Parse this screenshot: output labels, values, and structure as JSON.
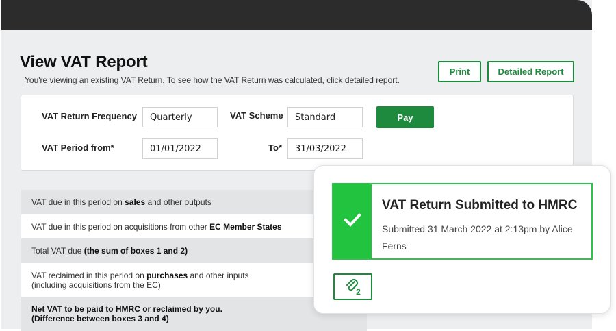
{
  "header": {
    "title": "View VAT Report",
    "subtitle": "You're viewing an existing VAT Return. To see how the VAT Return was calculated, click detailed report."
  },
  "actions": {
    "print_label": "Print",
    "detailed_label": "Detailed Report",
    "pay_label": "Pay"
  },
  "form": {
    "frequency_label": "VAT Return Frequency",
    "frequency_value": "Quarterly",
    "scheme_label": "VAT Scheme",
    "scheme_value": "Standard",
    "period_from_label": "VAT Period from*",
    "period_from_value": "01/01/2022",
    "to_label": "To*",
    "to_value": "31/03/2022"
  },
  "vat_rows": [
    {
      "pre": "VAT due in this period on ",
      "bold": "sales",
      "post": " and other outputs"
    },
    {
      "pre": "VAT due in this period on acquisitions from other ",
      "bold": "EC Member States",
      "post": ""
    },
    {
      "pre": "Total VAT due ",
      "bold": "(the sum of boxes 1 and 2)",
      "post": ""
    },
    {
      "pre": "VAT reclaimed in this period on ",
      "bold": "purchases",
      "post": " and other inputs",
      "line2": "(including acquisitions from the EC)"
    },
    {
      "pre": "",
      "bold": "Net VAT to be paid to HMRC or reclaimed by you.",
      "post": "",
      "line2_bold": "(Difference between boxes 3 and 4)"
    }
  ],
  "notification": {
    "title": "VAT Return Submitted to HMRC",
    "text": "Submitted 31 March 2022 at 2:13pm by Alice Ferns",
    "attachment_count": "2"
  },
  "colors": {
    "brand_green": "#1e8a3e",
    "success_green": "#22c33e",
    "topbar": "#2c2c2c"
  },
  "icons": [
    "checkmark-icon",
    "paperclip-icon"
  ]
}
